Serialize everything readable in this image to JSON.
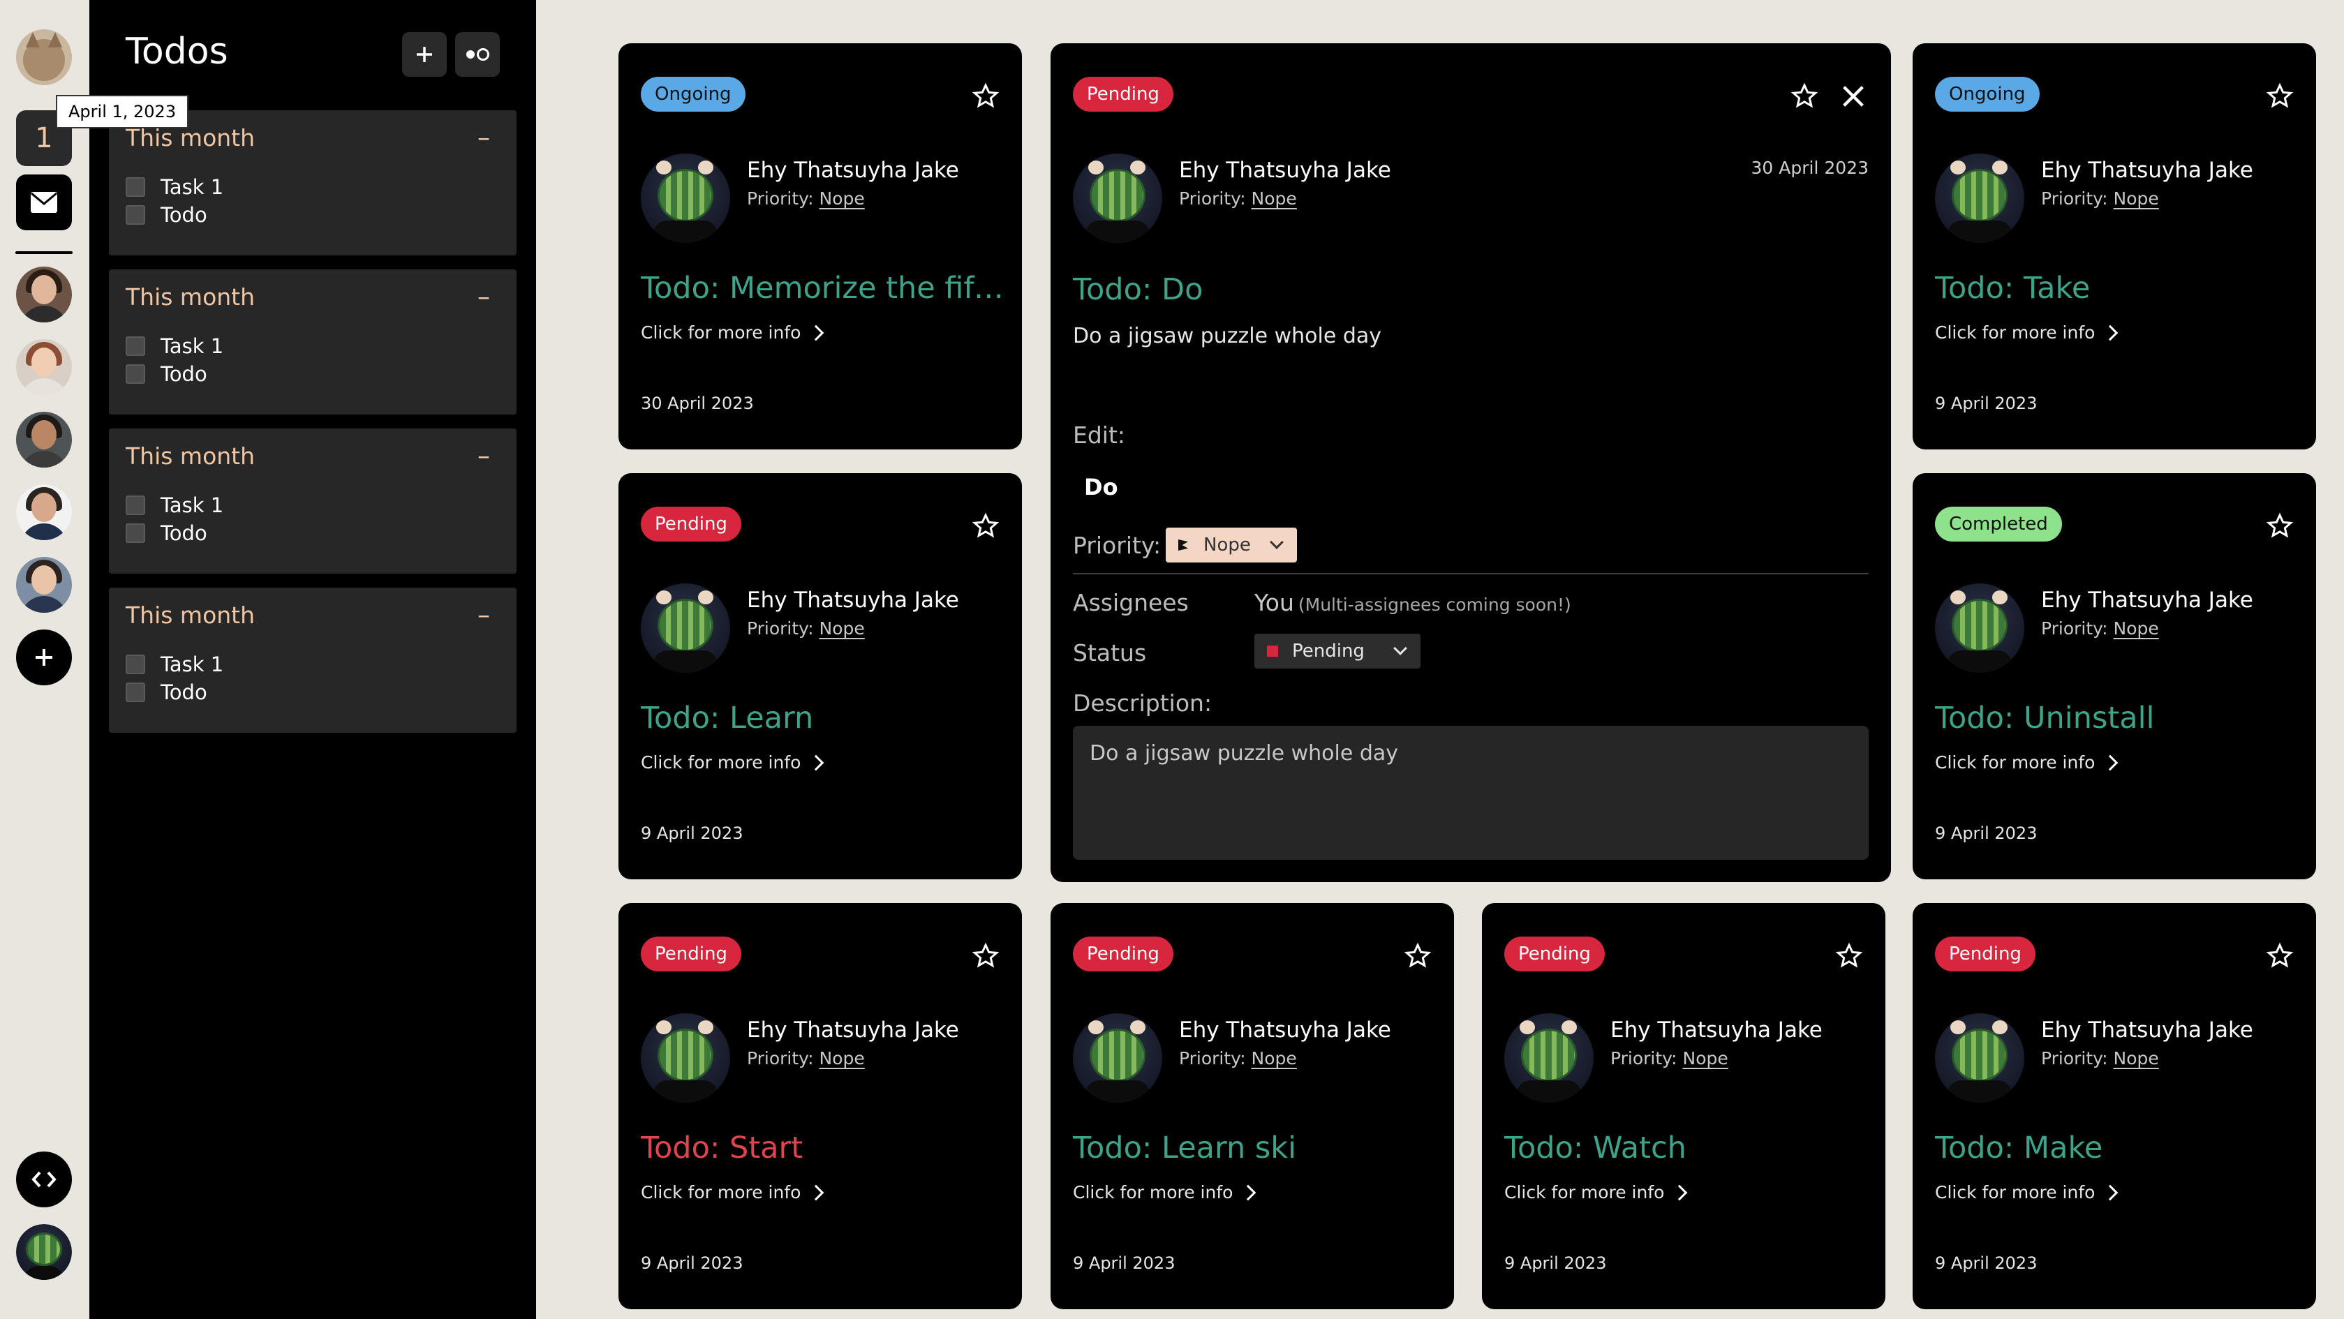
{
  "rail": {
    "tooltip": "April 1, 2023",
    "calendar_day": "1"
  },
  "sidebar": {
    "title": "Todos",
    "groups": [
      {
        "title": "This month",
        "tasks": [
          "Task 1",
          "Todo"
        ]
      },
      {
        "title": "This month",
        "tasks": [
          "Task 1",
          "Todo"
        ]
      },
      {
        "title": "This month",
        "tasks": [
          "Task 1",
          "Todo"
        ]
      },
      {
        "title": "This month",
        "tasks": [
          "Task 1",
          "Todo"
        ]
      }
    ]
  },
  "common": {
    "author": "Ehy Thatsuyha Jake",
    "priority_label": "Priority:",
    "priority_value": "Nope",
    "more": "Click for more info"
  },
  "cards": [
    {
      "status": "Ongoing",
      "title": "Todo: Memorize the fifty states",
      "date": "30 April 2023"
    },
    {
      "status": "Ongoing",
      "title": "Todo: Take",
      "date": "9 April 2023"
    },
    {
      "status": "Pending",
      "title": "Todo: Learn",
      "date": "9 April 2023"
    },
    {
      "status": "Completed",
      "title": "Todo: Uninstall",
      "date": "9 April 2023"
    },
    {
      "status": "Pending",
      "title": "Todo: Start",
      "date": "9 April 2023"
    },
    {
      "status": "Pending",
      "title": "Todo: Learn ski",
      "date": "9 April 2023"
    },
    {
      "status": "Pending",
      "title": "Todo: Watch",
      "date": "9 April 2023"
    },
    {
      "status": "Pending",
      "title": "Todo: Make",
      "date": "9 April 2023"
    }
  ],
  "expanded": {
    "status": "Pending",
    "date": "30 April 2023",
    "title": "Todo: Do",
    "description": "Do a jigsaw puzzle whole day",
    "edit_label": "Edit:",
    "edit_value": "Do",
    "priority_label": "Priority:",
    "priority_value": "Nope",
    "assignees_label": "Assignees",
    "assignees_value": "You",
    "assignees_note": "(Multi-assignees coming soon!)",
    "status_label": "Status",
    "status_value": "Pending",
    "description_label": "Description:",
    "description_value": "Do a jigsaw puzzle whole day"
  },
  "colors": {
    "ongoing": "#5aa9e6",
    "pending": "#d7263d",
    "completed": "#8ee28b",
    "title_teal": "#3fa389",
    "title_red": "#e0444f",
    "accent_peach": "#f0c5a4"
  }
}
